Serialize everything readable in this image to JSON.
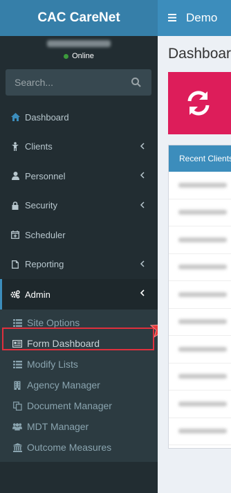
{
  "brand": {
    "title": "CAC CareNet"
  },
  "user": {
    "status": "Online",
    "status_color": "#3c9a3c"
  },
  "search": {
    "placeholder": "Search..."
  },
  "menu": [
    {
      "label": "Dashboard",
      "icon": "home-icon"
    },
    {
      "label": "Clients",
      "icon": "child-icon",
      "has_chevron": true
    },
    {
      "label": "Personnel",
      "icon": "user-icon",
      "has_chevron": true
    },
    {
      "label": "Security",
      "icon": "lock-icon",
      "has_chevron": true
    },
    {
      "label": "Scheduler",
      "icon": "calendar-plus-icon"
    },
    {
      "label": "Reporting",
      "icon": "file-icon",
      "has_chevron": true
    },
    {
      "label": "Admin",
      "icon": "cogs-icon",
      "has_chevron": true,
      "active": true
    }
  ],
  "admin_submenu": [
    {
      "label": "Site Options",
      "icon": "list-icon"
    },
    {
      "label": "Form Dashboard",
      "icon": "form-card-icon",
      "highlighted": true
    },
    {
      "label": "Modify Lists",
      "icon": "list-icon"
    },
    {
      "label": "Agency Manager",
      "icon": "building-icon"
    },
    {
      "label": "Document Manager",
      "icon": "copy-icon"
    },
    {
      "label": "MDT Manager",
      "icon": "users-icon"
    },
    {
      "label": "Outcome Measures",
      "icon": "institution-icon"
    }
  ],
  "topbar": {
    "title": "Demo"
  },
  "content": {
    "title": "Dashboard",
    "refresh_tile_color": "#dd1d5a",
    "panel_title": "Recent Clients"
  },
  "colors": {
    "sidebar_bg": "#222d32",
    "brand_bg": "#367fa9",
    "accent": "#3c8dbc",
    "highlight_border": "#e0303d"
  }
}
